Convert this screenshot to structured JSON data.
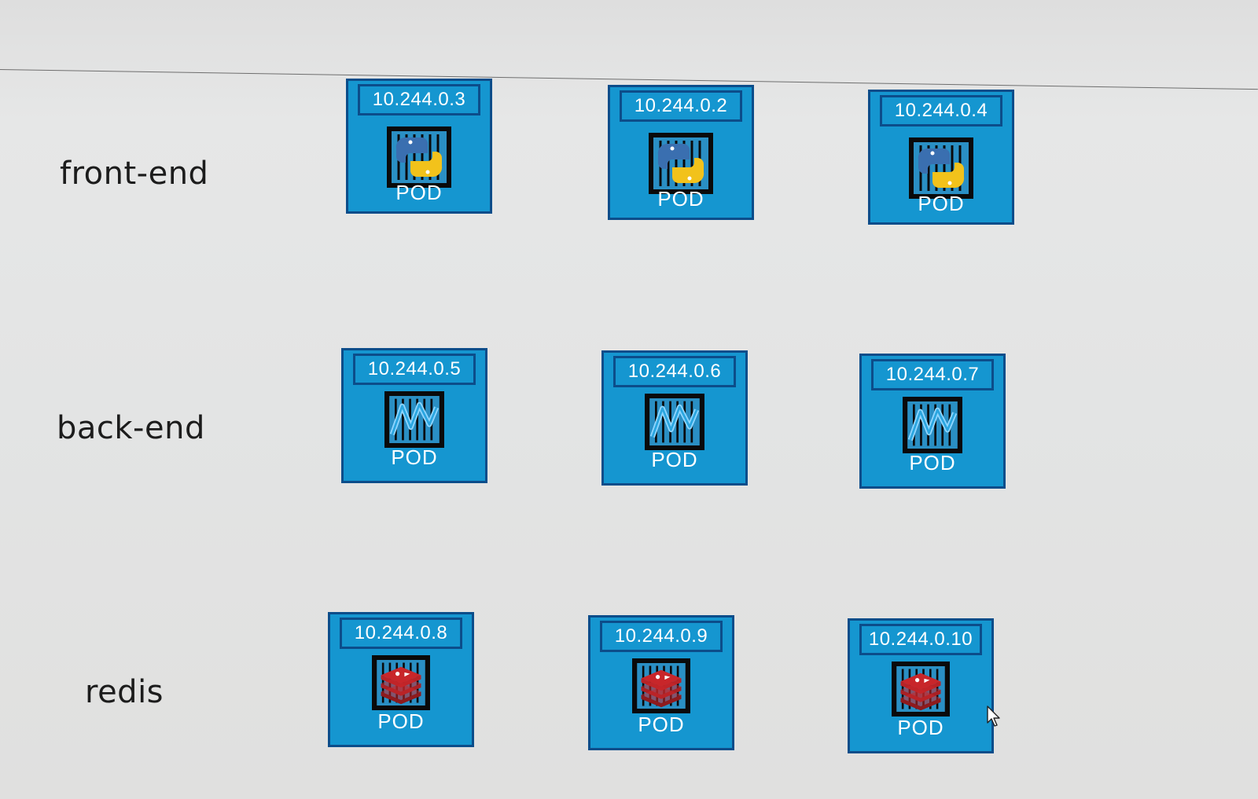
{
  "groups": [
    {
      "label": "front-end",
      "icon": "python-icon",
      "pods": [
        {
          "ip": "10.244.0.3",
          "label": "POD"
        },
        {
          "ip": "10.244.0.2",
          "label": "POD"
        },
        {
          "ip": "10.244.0.4",
          "label": "POD"
        }
      ]
    },
    {
      "label": "back-end",
      "icon": "nodejs-icon",
      "pods": [
        {
          "ip": "10.244.0.5",
          "label": "POD"
        },
        {
          "ip": "10.244.0.6",
          "label": "POD"
        },
        {
          "ip": "10.244.0.7",
          "label": "POD"
        }
      ]
    },
    {
      "label": "redis",
      "icon": "redis-icon",
      "pods": [
        {
          "ip": "10.244.0.8",
          "label": "POD"
        },
        {
          "ip": "10.244.0.9",
          "label": "POD"
        },
        {
          "ip": "10.244.0.10",
          "label": "POD"
        }
      ]
    }
  ],
  "colors": {
    "pod_fill": "#1596d0",
    "pod_border": "#0c4d8a",
    "python_blue": "#3a6fb0",
    "python_yellow": "#f2c21b",
    "node_blue": "#2aa6e0",
    "redis_red": "#c8262a"
  }
}
